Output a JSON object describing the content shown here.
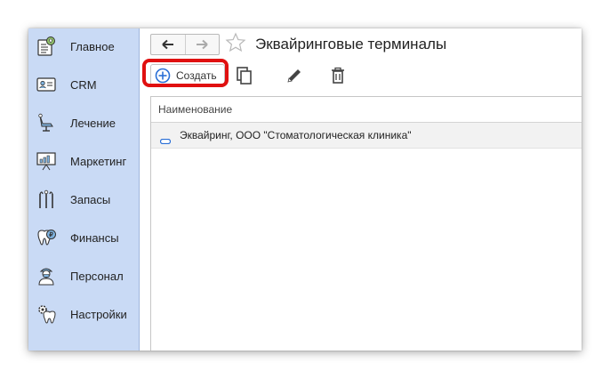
{
  "window": {
    "title": "Эквайринговые терминалы"
  },
  "sidebar": {
    "items": [
      {
        "label": "Главное",
        "icon": "home-icon"
      },
      {
        "label": "CRM",
        "icon": "id-card-icon"
      },
      {
        "label": "Лечение",
        "icon": "dental-chair-icon"
      },
      {
        "label": "Маркетинг",
        "icon": "presentation-chart-icon"
      },
      {
        "label": "Запасы",
        "icon": "dental-tools-icon"
      },
      {
        "label": "Финансы",
        "icon": "tooth-coin-icon"
      },
      {
        "label": "Персонал",
        "icon": "doctor-icon"
      },
      {
        "label": "Настройки",
        "icon": "tooth-gear-icon"
      }
    ]
  },
  "toolbar": {
    "create_label": "Создать",
    "copy_icon": "copy-icon",
    "edit_icon": "pencil-icon",
    "delete_icon": "trash-icon",
    "highlight_color": "#e01010"
  },
  "table": {
    "columns": [
      "Наименование"
    ],
    "rows": [
      {
        "name": "Эквайринг, ООО \"Стоматологическая клиника\""
      }
    ]
  },
  "colors": {
    "sidebar_bg": "#c9daf5",
    "accent": "#2a6fd6"
  }
}
